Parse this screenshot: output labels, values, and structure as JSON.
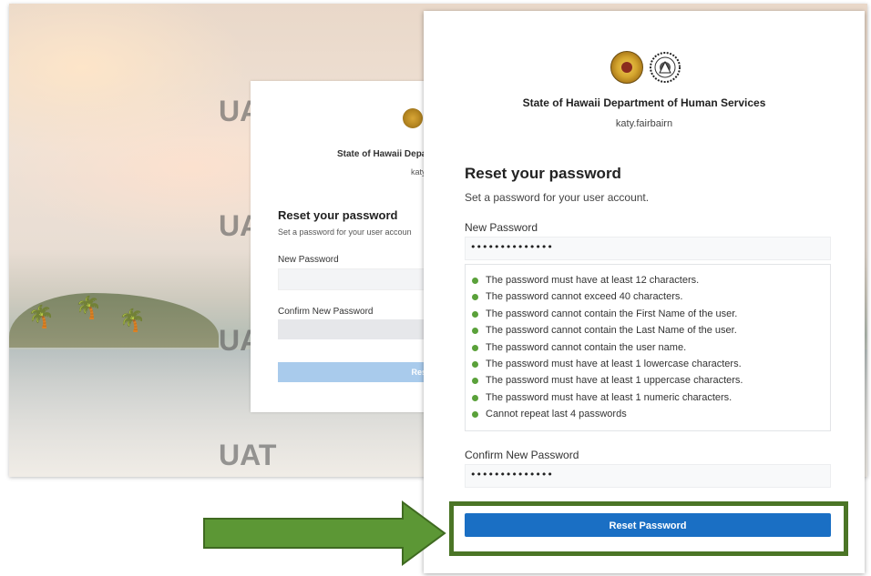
{
  "background_screen": {
    "watermark": "UAT",
    "org_name": "State of Hawaii Depa",
    "username": "katy",
    "title": "Reset your password",
    "subtitle": "Set a password for your user accoun",
    "new_password_label": "New Password",
    "confirm_password_label": "Confirm New Password",
    "reset_button": "Reset"
  },
  "card": {
    "org_name": "State of Hawaii Department of Human Services",
    "username": "katy.fairbairn",
    "title": "Reset your password",
    "subtitle": "Set a password for your user account.",
    "new_password": {
      "label": "New Password",
      "value": "••••••••••••••"
    },
    "rules": [
      "The password must have at least 12 characters.",
      "The password cannot exceed 40 characters.",
      "The password cannot contain the First Name of the user.",
      "The password cannot contain the Last Name of the user.",
      "The password cannot contain the user name.",
      "The password must have at least 1 lowercase characters.",
      "The password must have at least 1 uppercase characters.",
      "The password must have at least 1 numeric characters.",
      "Cannot repeat last 4 passwords"
    ],
    "confirm_password": {
      "label": "Confirm New Password",
      "value": "••••••••••••••"
    },
    "reset_button": "Reset Password"
  },
  "colors": {
    "button": "#1a6fc4",
    "rule_dot": "#5aa13a",
    "annotation_green": "#4b7526",
    "arrow_fill": "#5c9735"
  },
  "icons": {
    "seal_hawaii": "state-seal-icon",
    "seal_dhs": "dhs-seal-icon",
    "rule_bullet": "green-dot-icon",
    "annotation_arrow": "right-arrow-icon"
  }
}
